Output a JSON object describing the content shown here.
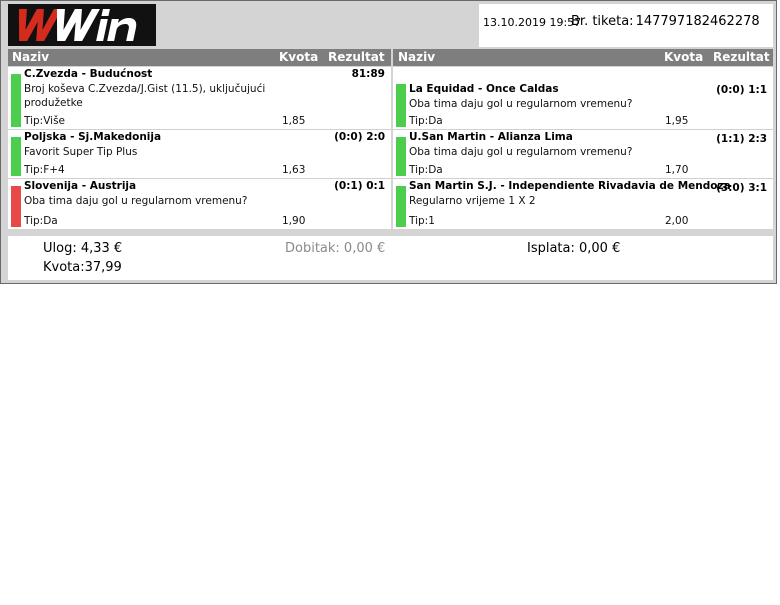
{
  "logo": {
    "text": "WWin",
    "colors": {
      "first_w": "#d52b1e",
      "rest": "#ffffff",
      "background": "#111111"
    }
  },
  "header": {
    "date": "13.10.2019 19:57",
    "ticket_label": "Br. tiketa:",
    "ticket_number": "147797182462278"
  },
  "columns": {
    "naziv": "Naziv",
    "kvota": "Kvota",
    "rezultat": "Rezultat"
  },
  "bets_left": [
    {
      "match": "C.Zvezda - Budućnost",
      "description": "Broj koševa C.Zvezda/J.Gist (11.5), uključujući produžetke",
      "tip": "Tip:Više",
      "odd": "1,85",
      "score": "81:89",
      "status": "green"
    },
    {
      "match": "Poljska - Sj.Makedonija",
      "description": "Favorit Super Tip Plus",
      "tip": "Tip:F+4",
      "odd": "1,63",
      "score": "(0:0) 2:0",
      "status": "green"
    },
    {
      "match": "Slovenija - Austrija",
      "description": "Oba tima daju gol u regularnom vremenu?",
      "tip": "Tip:Da",
      "odd": "1,90",
      "score": "(0:1) 0:1",
      "status": "red"
    }
  ],
  "bets_right": [
    {
      "match": "La Equidad - Once Caldas",
      "description": "Oba tima daju gol u regularnom vremenu?",
      "tip": "Tip:Da",
      "odd": "1,95",
      "score": "(0:0) 1:1",
      "status": "green"
    },
    {
      "match": "U.San Martin - Alianza Lima",
      "description": "Oba tima daju gol u regularnom vremenu?",
      "tip": "Tip:Da",
      "odd": "1,70",
      "score": "(1:1) 2:3",
      "status": "green"
    },
    {
      "match": "San Martin S.J. - Independiente Rivadavia de Mendoza",
      "description": "Regularno vrijeme 1 X 2",
      "tip": "Tip:1",
      "odd": "2,00",
      "score": "(3:0) 3:1",
      "status": "green"
    }
  ],
  "summary": {
    "ulog": "Ulog: 4,33 €",
    "dobitak": "Dobitak: 0,00 €",
    "isplata": "Isplata: 0,00 €",
    "kvota": "Kvota:37,99"
  },
  "colors": {
    "win": "#4ccd4c",
    "loss": "#e84848",
    "header_bar": "#7e7e7e"
  }
}
